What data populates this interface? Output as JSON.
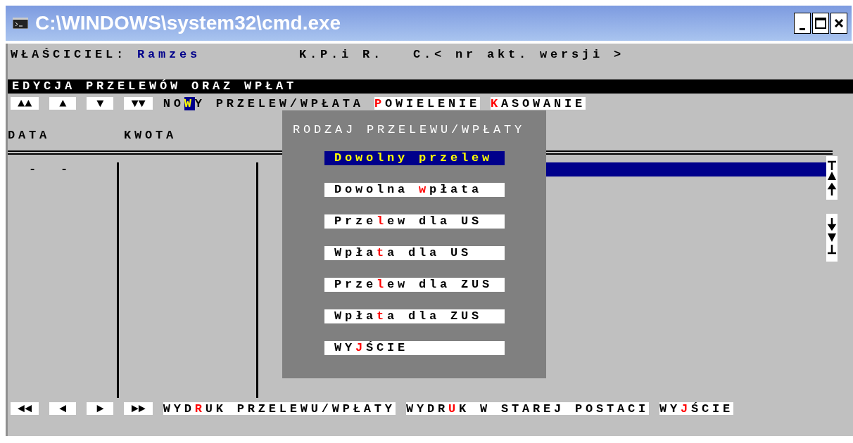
{
  "window": {
    "title": "C:\\WINDOWS\\system32\\cmd.exe"
  },
  "header": {
    "owner_label": "WŁAŚCICIEL:",
    "owner": "Ramzes",
    "program": "K.P.i R.",
    "version": "C.< nr akt. wersji >"
  },
  "section_title": "EDYCJA PRZELEWÓW ORAZ WPŁAT",
  "top_nav": [
    "▲▲",
    "▲",
    "▼",
    "▼▼"
  ],
  "top_actions": [
    {
      "kind": "plain",
      "before": "NO",
      "hotkey": "W",
      "after": "Y PRZELEW/WPŁATA",
      "cursor": true
    },
    {
      "kind": "boxed",
      "hotkey": "P",
      "after": "OWIELENIE",
      "cursor": false,
      "color": "#ff0000"
    },
    {
      "kind": "boxed",
      "hotkey": "K",
      "after": "ASOWANIE",
      "cursor": false,
      "color": "#ff0000"
    }
  ],
  "columns": [
    "DATA",
    "KWOTA"
  ],
  "rows": [
    {
      "date": "-  -"
    }
  ],
  "dialog": {
    "title": "RODZAJ PRZELEWU/WPŁATY",
    "options": [
      {
        "before": "Dowolny przelew",
        "selected": true
      },
      {
        "before": "Dowolna ",
        "hotkey": "w",
        "after": "płata",
        "color": "#ff0000",
        "selected": false
      },
      {
        "before": "Prze",
        "hotkey": "l",
        "after": "ew dla US",
        "color": "#ff0000",
        "selected": false
      },
      {
        "before": "Wpła",
        "hotkey": "t",
        "after": "a dla US",
        "color": "#ff0000",
        "selected": false
      },
      {
        "before": "Prze",
        "hotkey": "l",
        "after": "ew dla ZUS",
        "color": "#ff0000",
        "selected": false
      },
      {
        "before": "Wpła",
        "hotkey": "t",
        "after": "a dla ZUS",
        "color": "#ff0000",
        "selected": false
      },
      {
        "before": "WY",
        "hotkey": "J",
        "after": "ŚCIE",
        "color": "#ff0000",
        "selected": false
      }
    ]
  },
  "bottom_nav": [
    "◄◄",
    "◄",
    "►",
    "►►"
  ],
  "bottom_actions": [
    {
      "kind": "boxed",
      "before": "WYD",
      "hotkey": "R",
      "after": "UK PRZELEWU/WPŁATY",
      "color": "#ff0000"
    },
    {
      "kind": "boxed",
      "before": "WYDR",
      "hotkey": "U",
      "after": "K W STAREJ POSTACI",
      "color": "#ff0000"
    },
    {
      "kind": "boxed",
      "before": "WY",
      "hotkey": "J",
      "after": "ŚCIE",
      "color": "#ff0000"
    }
  ]
}
